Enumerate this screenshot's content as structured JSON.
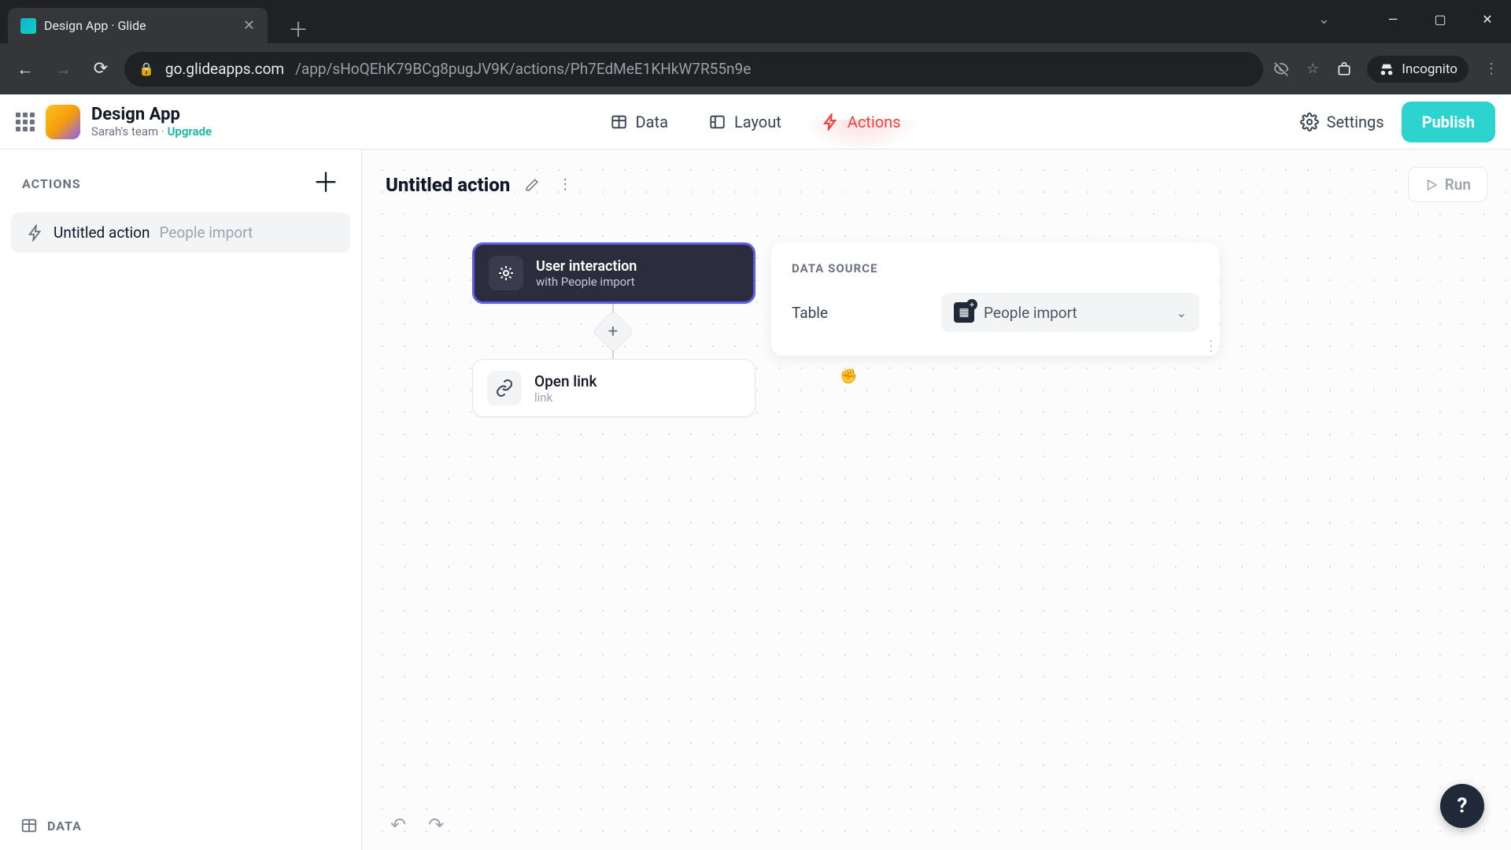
{
  "browser": {
    "tab_title": "Design App · Glide",
    "url_host": "go.glideapps.com",
    "url_path": "/app/sHoQEhK79BCg8pugJV9K/actions/Ph7EdMeE1KHkW7R55n9e",
    "incognito_label": "Incognito"
  },
  "header": {
    "app_name": "Design App",
    "team_name": "Sarah's team",
    "separator": " · ",
    "upgrade_label": "Upgrade",
    "tabs": {
      "data": "Data",
      "layout": "Layout",
      "actions": "Actions"
    },
    "settings_label": "Settings",
    "publish_label": "Publish"
  },
  "sidebar": {
    "heading": "ACTIONS",
    "item": {
      "name": "Untitled action",
      "source": "People import"
    },
    "footer_label": "DATA"
  },
  "canvas": {
    "action_title": "Untitled action",
    "run_label": "Run",
    "trigger": {
      "title": "User interaction",
      "subtitle": "with People import"
    },
    "step": {
      "title": "Open link",
      "subtitle": "link"
    }
  },
  "inspector": {
    "heading": "DATA SOURCE",
    "field_label": "Table",
    "select_value": "People import"
  },
  "help_label": "?"
}
